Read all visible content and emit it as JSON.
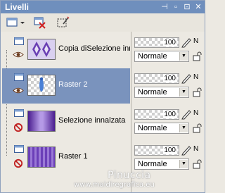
{
  "window": {
    "title": "Livelli",
    "buttons": {
      "pin": "⊣",
      "minimize": "▫",
      "maximize": "⊡",
      "close": "✕"
    }
  },
  "toolbar": {
    "tools": [
      {
        "name": "new-layer-icon"
      },
      {
        "name": "dropdown-arrow-icon"
      },
      {
        "name": "delete-layer-icon"
      },
      {
        "name": "selection-edit-icon"
      }
    ]
  },
  "layers": [
    {
      "name": "Copia diSelezione inna",
      "opacity": "100",
      "blend": "Normale",
      "visible": true,
      "selected": false,
      "thumb": "purple-diamonds"
    },
    {
      "name": "Raster 2",
      "opacity": "100",
      "blend": "Normale",
      "visible": true,
      "selected": true,
      "thumb": "blue-figure"
    },
    {
      "name": "Selezione innalzata",
      "opacity": "100",
      "blend": "Normale",
      "visible": false,
      "selected": false,
      "thumb": "purple-gradient"
    },
    {
      "name": "Raster 1",
      "opacity": "100",
      "blend": "Normale",
      "visible": false,
      "selected": false,
      "thumb": "purple-pattern"
    }
  ],
  "prop_pen_label": "N",
  "watermark": {
    "line1": "Pinuccia",
    "line2": "www.maidiregrafica.eu"
  },
  "colors": {
    "titlebar": "#6f8fbd",
    "selected_row": "#7a93bd",
    "panel_bg": "#ece9e2"
  }
}
